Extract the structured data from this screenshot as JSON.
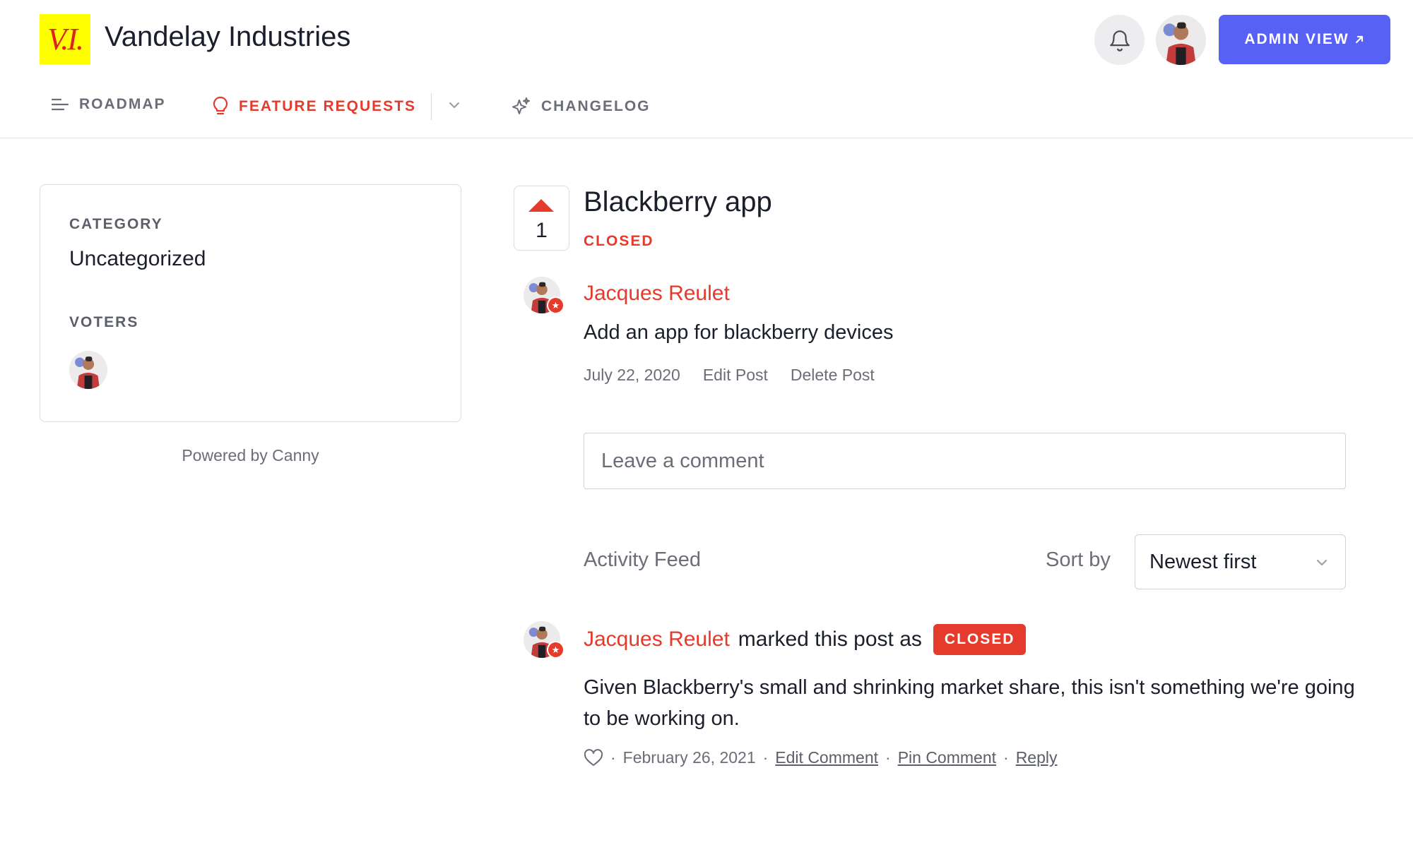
{
  "header": {
    "logo_text": "V.I.",
    "company_name": "Vandelay Industries",
    "admin_button": "ADMIN VIEW",
    "admin_button_icon": "arrow-up-right-icon"
  },
  "nav": {
    "items": [
      {
        "label": "ROADMAP",
        "icon": "roadmap-lines-icon"
      },
      {
        "label": "FEATURE REQUESTS",
        "icon": "lightbulb-icon",
        "active": true
      },
      {
        "label": "CHANGELOG",
        "icon": "sparkle-icon"
      }
    ]
  },
  "sidebar": {
    "category_label": "CATEGORY",
    "category_value": "Uncategorized",
    "voters_label": "VOTERS",
    "powered_by": "Powered by Canny"
  },
  "post": {
    "votes": "1",
    "title": "Blackberry app",
    "status": "CLOSED",
    "author": "Jacques Reulet",
    "body": "Add an app for blackberry devices",
    "date": "July 22, 2020",
    "edit_label": "Edit Post",
    "delete_label": "Delete Post"
  },
  "comment_input": {
    "placeholder": "Leave a comment"
  },
  "activity": {
    "label": "Activity Feed",
    "sort_label": "Sort by",
    "sort_value": "Newest first",
    "entry": {
      "author": "Jacques Reulet",
      "action": "marked this post as",
      "status": "CLOSED",
      "text": "Given Blackberry's small and shrinking market share, this isn't something we're going to be working on.",
      "date": "February 26, 2021",
      "edit_label": "Edit Comment",
      "pin_label": "Pin Comment",
      "reply_label": "Reply"
    }
  },
  "colors": {
    "accent": "#e53b2c",
    "admin_button": "#5861f5",
    "logo_bg": "#ffff00"
  }
}
